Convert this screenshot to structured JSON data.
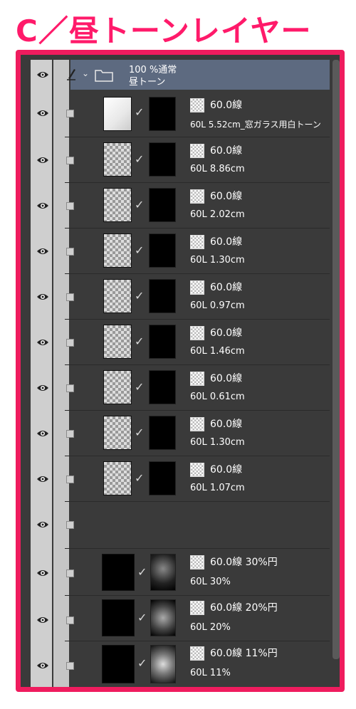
{
  "title": "C／昼トーンレイヤー",
  "folder": {
    "opacity_blend": "100 %通常",
    "name": "昼トーン"
  },
  "layers": [
    {
      "name": "60.0線",
      "sub": "60L 5.52cm_窓ガラス用白トーン"
    },
    {
      "name": "60.0線",
      "sub": "60L 8.86cm"
    },
    {
      "name": "60.0線",
      "sub": "60L 2.02cm"
    },
    {
      "name": "60.0線",
      "sub": "60L 1.30cm"
    },
    {
      "name": "60.0線",
      "sub": "60L 0.97cm"
    },
    {
      "name": "60.0線",
      "sub": "60L 1.46cm"
    },
    {
      "name": "60.0線",
      "sub": "60L 0.61cm"
    },
    {
      "name": "60.0線",
      "sub": "60L 1.30cm"
    },
    {
      "name": "60.0線",
      "sub": "60L 1.07cm"
    },
    {
      "name": "",
      "sub": ""
    },
    {
      "name": "60.0線 30%円",
      "sub": "60L 30%"
    },
    {
      "name": "60.0線 20%円",
      "sub": "60L 20%"
    },
    {
      "name": "60.0線 11%円",
      "sub": "60L 11%"
    }
  ],
  "icons": {
    "visibility": "eye-icon",
    "edit": "pencil-icon",
    "folder": "folder-icon",
    "expand": "chevron-down-icon",
    "tone": "screentone-icon",
    "mask_link": "checkmark-icon"
  },
  "colors": {
    "accent": "#ef1c5e",
    "folder_row": "#5d6a80",
    "panel": "#3a3a3a"
  }
}
